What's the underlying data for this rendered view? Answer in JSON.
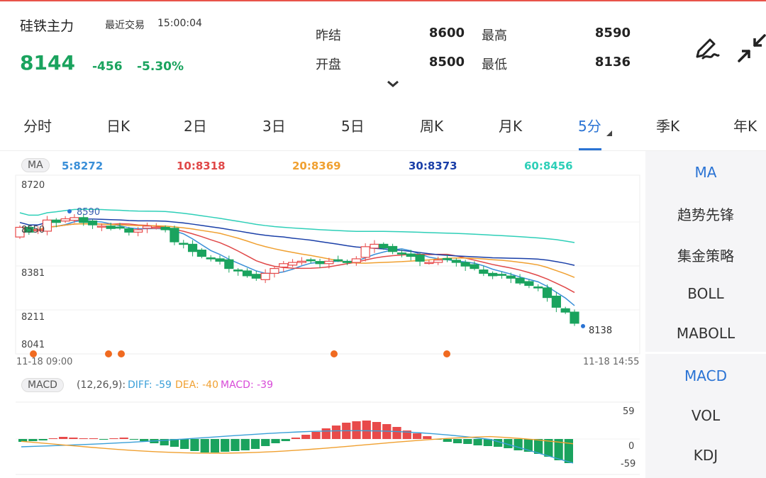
{
  "header": {
    "name": "硅铁主力",
    "recent_label": "最近交易",
    "time": "15:00:04",
    "price": "8144",
    "change": "-456",
    "change_pct": "-5.30%"
  },
  "quotes": {
    "prev_settle_label": "昨结",
    "prev_settle": "8600",
    "high_label": "最高",
    "high": "8590",
    "open_label": "开盘",
    "open": "8500",
    "low_label": "最低",
    "low": "8136"
  },
  "tabs": [
    "分时",
    "日K",
    "2日",
    "3日",
    "5日",
    "周K",
    "月K",
    "5分",
    "季K",
    "年K"
  ],
  "active_tab": "5分",
  "ma": {
    "pill": "MA",
    "items": [
      {
        "label": "5:8272",
        "color": "#3a8fd8"
      },
      {
        "label": "10:8318",
        "color": "#e04848"
      },
      {
        "label": "20:8369",
        "color": "#f0a030"
      },
      {
        "label": "30:8373",
        "color": "#1a3fa8"
      },
      {
        "label": "60:8456",
        "color": "#2ecfb8"
      }
    ]
  },
  "price_axis": [
    "8720",
    "8550",
    "8381",
    "8211",
    "8041"
  ],
  "markers": {
    "high_mark": "8590",
    "low_mark": "8138"
  },
  "time_axis": {
    "start": "11-18 09:00",
    "end": "11-18 14:55"
  },
  "macd": {
    "pill": "MACD",
    "params": "(12,26,9):",
    "diff": "DIFF: -59",
    "dea": "DEA: -40",
    "macd": "MACD: -39",
    "axis": [
      "59",
      "0",
      "-59"
    ]
  },
  "side_panel_top": [
    "MA",
    "趋势先锋",
    "集金策略",
    "BOLL",
    "MABOLL"
  ],
  "side_panel_bottom": [
    "MACD",
    "VOL",
    "KDJ"
  ],
  "colors": {
    "up": "#e84a4a",
    "down": "#1aa35e",
    "accent": "#2a73d4"
  }
}
